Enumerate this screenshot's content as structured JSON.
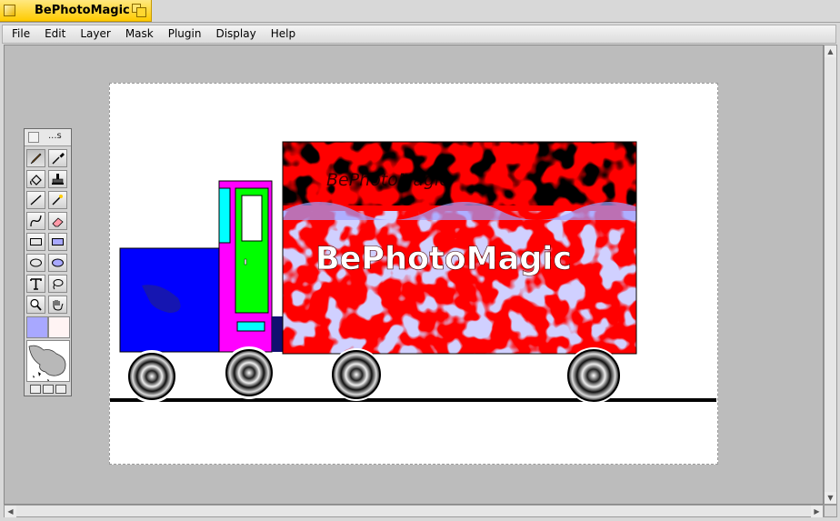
{
  "window": {
    "title": "BePhotoMagic"
  },
  "menu": [
    "File",
    "Edit",
    "Layer",
    "Mask",
    "Plugin",
    "Display",
    "Help"
  ],
  "palette": {
    "title": "...s",
    "tools": [
      "brush",
      "eyedropper",
      "fill-bucket",
      "stamp",
      "line",
      "magic-wand",
      "freehand-curve",
      "eraser",
      "rectangle-outline",
      "rectangle-filled",
      "ellipse-outline",
      "ellipse-filled",
      "text",
      "lasso",
      "zoom",
      "hand"
    ],
    "foreground_color": "#a8a8ff",
    "background_color": "#fff4f4"
  },
  "image": {
    "banner_text": "BePhotoMagic",
    "ghost_text": "BePhotoMagic",
    "colors": {
      "cab_blue": "#0000ff",
      "cab_magenta": "#ff00ff",
      "door_green": "#00ff00",
      "window_cyan": "#00ffff",
      "box_red": "#ff0000",
      "box_lavender": "#a0a0ff"
    }
  }
}
